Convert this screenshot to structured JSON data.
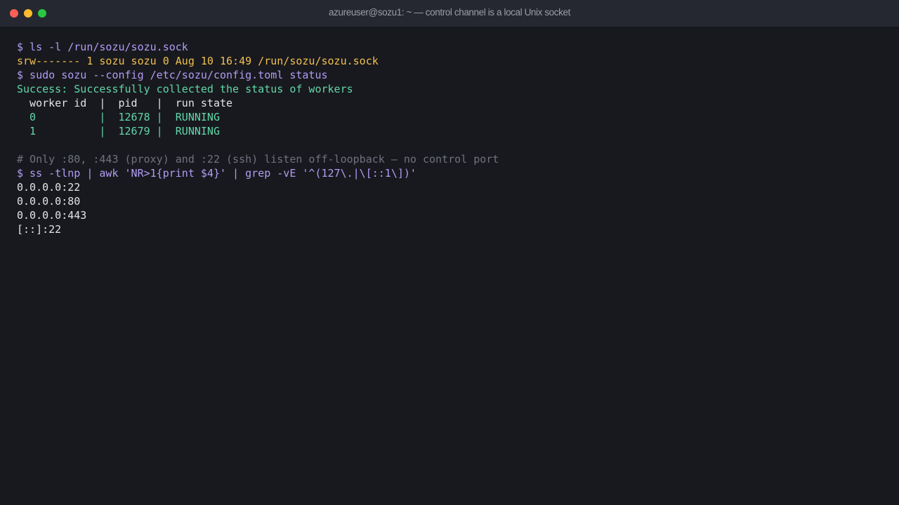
{
  "window": {
    "title": "azureuser@sozu1: ~ — control channel is a local Unix socket",
    "buttons": [
      "close",
      "minimize",
      "zoom"
    ]
  },
  "terminal": {
    "colors": {
      "background": "#18191e",
      "command": "#b29cf5",
      "warning": "#f1c04d",
      "success": "#61d6a9",
      "plain": "#e3e4e8",
      "comment": "#6f737e"
    },
    "lines": [
      "$ ls -l /run/sozu/sozu.sock",
      "srw------- 1 sozu sozu 0 Aug 10 16:49 /run/sozu/sozu.sock",
      "$ sudo sozu --config /etc/sozu/config.toml status",
      "Success: Successfully collected the status of workers",
      "  worker id  |  pid   |  run state",
      "  0          |  12678 |  RUNNING",
      "  1          |  12679 |  RUNNING",
      "",
      "# Only :80, :443 (proxy) and :22 (ssh) listen off-loopback — no control port",
      "$ ss -tlnp | awk 'NR>1{print $4}' | grep -vE '^(127\\.|\\[::1\\])'",
      "0.0.0.0:22",
      "0.0.0.0:80",
      "0.0.0.0:443",
      "[::]:22"
    ]
  }
}
